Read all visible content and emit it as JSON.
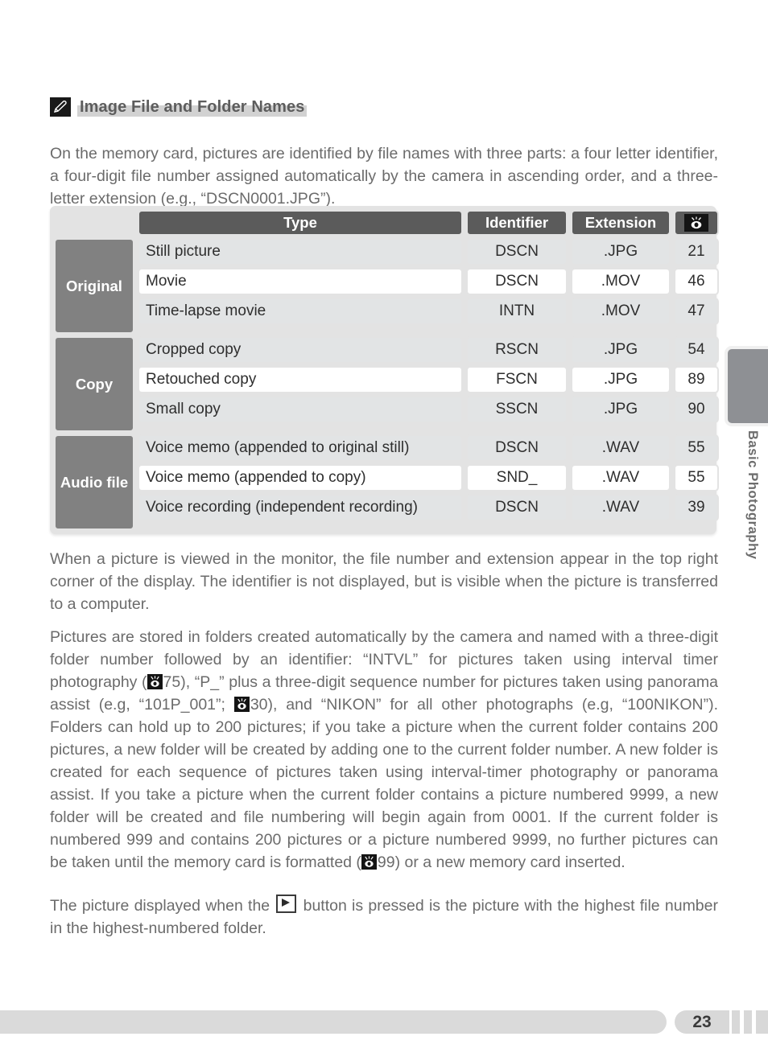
{
  "heading": {
    "icon": "pencil-icon",
    "text": "Image File and Folder Names"
  },
  "paragraphs": {
    "intro_a": "On the memory card, pictures are identified by file names with three parts: a four letter identifier, a four-digit file number assigned automatically by the camera in ascending order, and a three-letter extension (e.g., “DSCN0001.JPG”).",
    "after_table": "When a picture is viewed in the monitor, the file number and extension appear in the top right corner of the display.  The identifier is not displayed, but is visible when the picture is transferred to a computer.",
    "folder_1": "Pictures are stored in folders created automatically by the camera and named with a three-digit folder number followed by an identifier: “INTVL” for pictures taken using interval timer photography (",
    "folder_ref_1": "75",
    "folder_2": "), “P_” plus a three-digit sequence number for pictures taken using panorama assist (e.g, “101P_001”; ",
    "folder_ref_2": "30",
    "folder_3": "), and “NIKON” for all other photographs (e.g, “100NIKON”).  Folders can hold up to 200 pictures; if you take a picture when the current folder contains 200 pictures, a new folder will be created by adding one to the current folder number.  A new folder is created for each sequence of pictures taken using interval-timer photography or panorama assist.  If you take a picture when the current folder contains a picture numbered 9999, a new folder will be created and file numbering will begin again from 0001.  If the current folder is numbered 999 and contains 200 pictures or a picture numbered 9999, no further pictures can be taken until the memory card is formatted (",
    "folder_ref_3": "99",
    "folder_4": ") or a new memory card inserted.",
    "last_1": "The picture displayed when the ",
    "last_2": " button is pressed is the picture with the highest file number in the highest-numbered folder."
  },
  "table": {
    "headers": {
      "type": "Type",
      "identifier": "Identifier",
      "extension": "Extension",
      "reference": "eye-reference-icon"
    },
    "groups": [
      {
        "label": "Original",
        "rows": [
          {
            "type": "Still picture",
            "identifier": "DSCN",
            "extension": ".JPG",
            "ref": "21",
            "shade": "light"
          },
          {
            "type": "Movie",
            "identifier": "DSCN",
            "extension": ".MOV",
            "ref": "46",
            "shade": "white"
          },
          {
            "type": "Time-lapse movie",
            "identifier": "INTN",
            "extension": ".MOV",
            "ref": "47",
            "shade": "light"
          }
        ]
      },
      {
        "label": "Copy",
        "rows": [
          {
            "type": "Cropped copy",
            "identifier": "RSCN",
            "extension": ".JPG",
            "ref": "54",
            "shade": "light"
          },
          {
            "type": "Retouched copy",
            "identifier": "FSCN",
            "extension": ".JPG",
            "ref": "89",
            "shade": "white"
          },
          {
            "type": "Small copy",
            "identifier": "SSCN",
            "extension": ".JPG",
            "ref": "90",
            "shade": "light"
          }
        ]
      },
      {
        "label": "Audio file",
        "rows": [
          {
            "type": "Voice memo (appended to original still)",
            "identifier": "DSCN",
            "extension": ".WAV",
            "ref": "55",
            "shade": "light"
          },
          {
            "type": "Voice memo (appended to copy)",
            "identifier": "SND_",
            "extension": ".WAV",
            "ref": "55",
            "shade": "white"
          },
          {
            "type": "Voice recording (independent recording)",
            "identifier": "DSCN",
            "extension": ".WAV",
            "ref": "39",
            "shade": "light"
          }
        ]
      }
    ]
  },
  "side_tab": {
    "label": "Basic Photography"
  },
  "footer": {
    "page_number": "23"
  },
  "colors": {
    "header_gray": "#5b5b5b",
    "group_gray": "#818181",
    "cell_light": "#e2e4e5",
    "cell_white": "#ffffff",
    "table_frame": "#e3e3e3",
    "body_text": "#6b6b6b",
    "heading_text": "#5d5d5d",
    "footer_gray": "#d8d8d8",
    "side_tab": "#8e9094"
  }
}
